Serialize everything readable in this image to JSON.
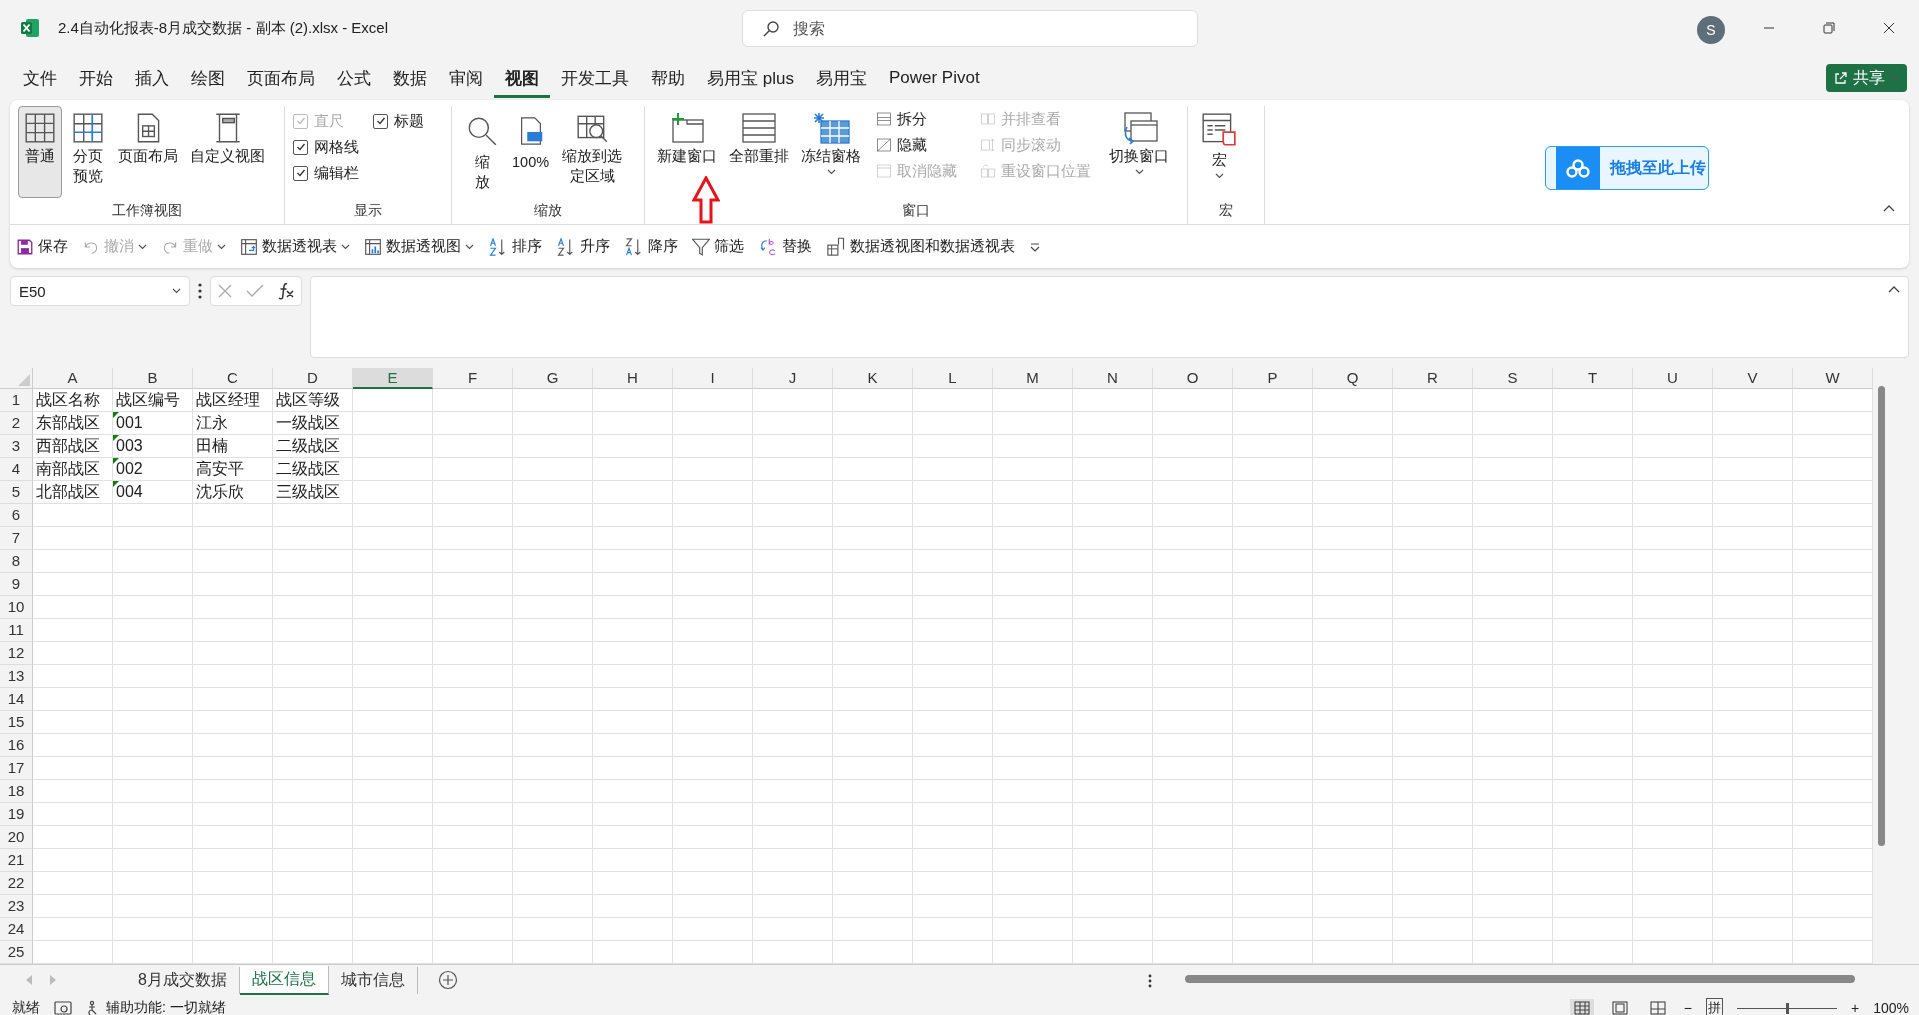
{
  "window": {
    "title": "2.4自动化报表-8月成交数据 - 副本 (2).xlsx  -  Excel",
    "search": {
      "placeholder": "搜索"
    },
    "avatar": "S"
  },
  "menu_tabs": [
    {
      "label": "文件",
      "selected": false
    },
    {
      "label": "开始",
      "selected": false
    },
    {
      "label": "插入",
      "selected": false
    },
    {
      "label": "绘图",
      "selected": false
    },
    {
      "label": "页面布局",
      "selected": false
    },
    {
      "label": "公式",
      "selected": false
    },
    {
      "label": "数据",
      "selected": false
    },
    {
      "label": "审阅",
      "selected": false
    },
    {
      "label": "视图",
      "selected": true
    },
    {
      "label": "开发工具",
      "selected": false
    },
    {
      "label": "帮助",
      "selected": false
    },
    {
      "label": "易用宝 plus",
      "selected": false
    },
    {
      "label": "易用宝",
      "selected": false
    },
    {
      "label": "Power Pivot",
      "selected": false
    }
  ],
  "share_button": "共享",
  "ribbon": {
    "workbook_views": {
      "label": "工作簿视图",
      "buttons": [
        {
          "label": "普通",
          "selected": true
        },
        {
          "label": "分页预览",
          "selected": false
        },
        {
          "label": "页面布局",
          "selected": false
        },
        {
          "label": "自定义视图",
          "selected": false
        }
      ]
    },
    "show": {
      "label": "显示",
      "checkboxes": [
        {
          "label": "直尺",
          "checked": true,
          "disabled": true
        },
        {
          "label": "网格线",
          "checked": true,
          "disabled": false
        },
        {
          "label": "编辑栏",
          "checked": true,
          "disabled": false
        },
        {
          "label": "标题",
          "checked": true,
          "disabled": false
        }
      ]
    },
    "zoom": {
      "label": "缩放",
      "buttons": [
        {
          "label": "缩放"
        },
        {
          "label": "100%"
        },
        {
          "label": "缩放到选定区域"
        }
      ]
    },
    "window": {
      "label": "窗口",
      "big_buttons": [
        {
          "label": "新建窗口",
          "dropdown": false
        },
        {
          "label": "全部重排",
          "dropdown": false
        },
        {
          "label": "冻结窗格",
          "dropdown": true
        }
      ],
      "small_buttons": [
        {
          "label": "拆分",
          "disabled": false
        },
        {
          "label": "隐藏",
          "disabled": false
        },
        {
          "label": "取消隐藏",
          "disabled": true
        },
        {
          "label": "并排查看",
          "disabled": true
        },
        {
          "label": "同步滚动",
          "disabled": true
        },
        {
          "label": "重设窗口位置",
          "disabled": true
        }
      ],
      "switch_button": {
        "label": "切换窗口",
        "dropdown": true
      }
    },
    "macros": {
      "label": "宏",
      "button": {
        "label": "宏",
        "dropdown": true
      }
    },
    "upload_button": "拖拽至此上传"
  },
  "quick_access": [
    {
      "label": "保存",
      "disabled": false,
      "dropdown": false
    },
    {
      "label": "撤消",
      "disabled": true,
      "dropdown": true
    },
    {
      "label": "重做",
      "disabled": true,
      "dropdown": true
    },
    {
      "label": "数据透视表",
      "disabled": false,
      "dropdown": true
    },
    {
      "label": "数据透视图",
      "disabled": false,
      "dropdown": true
    },
    {
      "label": "排序",
      "disabled": false,
      "dropdown": false
    },
    {
      "label": "升序",
      "disabled": false,
      "dropdown": false
    },
    {
      "label": "降序",
      "disabled": false,
      "dropdown": false
    },
    {
      "label": "筛选",
      "disabled": false,
      "dropdown": false
    },
    {
      "label": "替换",
      "disabled": false,
      "dropdown": false
    },
    {
      "label": "数据透视图和数据透视表",
      "disabled": false,
      "dropdown": false
    }
  ],
  "formula_bar": {
    "name_box": "E50"
  },
  "grid": {
    "columns": [
      {
        "label": "A",
        "selected": false
      },
      {
        "label": "B",
        "selected": false
      },
      {
        "label": "C",
        "selected": false
      },
      {
        "label": "D",
        "selected": false
      },
      {
        "label": "E",
        "selected": true
      },
      {
        "label": "F",
        "selected": false
      },
      {
        "label": "G",
        "selected": false
      },
      {
        "label": "H",
        "selected": false
      },
      {
        "label": "I",
        "selected": false
      },
      {
        "label": "J",
        "selected": false
      },
      {
        "label": "K",
        "selected": false
      },
      {
        "label": "L",
        "selected": false
      },
      {
        "label": "M",
        "selected": false
      },
      {
        "label": "N",
        "selected": false
      },
      {
        "label": "O",
        "selected": false
      },
      {
        "label": "P",
        "selected": false
      },
      {
        "label": "Q",
        "selected": false
      },
      {
        "label": "R",
        "selected": false
      },
      {
        "label": "S",
        "selected": false
      },
      {
        "label": "T",
        "selected": false
      },
      {
        "label": "U",
        "selected": false
      },
      {
        "label": "V",
        "selected": false
      },
      {
        "label": "W",
        "selected": false
      }
    ],
    "rows": [
      {
        "label": "1",
        "cells": [
          {
            "text": "战区名称",
            "error_mark": false
          },
          {
            "text": "战区编号",
            "error_mark": false
          },
          {
            "text": "战区经理",
            "error_mark": false
          },
          {
            "text": "战区等级",
            "error_mark": false
          }
        ]
      },
      {
        "label": "2",
        "cells": [
          {
            "text": "东部战区",
            "error_mark": false
          },
          {
            "text": "001",
            "error_mark": true
          },
          {
            "text": "江永",
            "error_mark": false
          },
          {
            "text": "一级战区",
            "error_mark": false
          }
        ]
      },
      {
        "label": "3",
        "cells": [
          {
            "text": "西部战区",
            "error_mark": false
          },
          {
            "text": "003",
            "error_mark": true
          },
          {
            "text": "田楠",
            "error_mark": false
          },
          {
            "text": "二级战区",
            "error_mark": false
          }
        ]
      },
      {
        "label": "4",
        "cells": [
          {
            "text": "南部战区",
            "error_mark": false
          },
          {
            "text": "002",
            "error_mark": true
          },
          {
            "text": "高安平",
            "error_mark": false
          },
          {
            "text": "二级战区",
            "error_mark": false
          }
        ]
      },
      {
        "label": "5",
        "cells": [
          {
            "text": "北部战区",
            "error_mark": false
          },
          {
            "text": "004",
            "error_mark": true
          },
          {
            "text": "沈乐欣",
            "error_mark": false
          },
          {
            "text": "三级战区",
            "error_mark": false
          }
        ]
      },
      {
        "label": "6"
      },
      {
        "label": "7"
      },
      {
        "label": "8"
      },
      {
        "label": "9"
      },
      {
        "label": "10"
      },
      {
        "label": "11"
      },
      {
        "label": "12"
      },
      {
        "label": "13"
      },
      {
        "label": "14"
      },
      {
        "label": "15"
      },
      {
        "label": "16"
      },
      {
        "label": "17"
      },
      {
        "label": "18"
      },
      {
        "label": "19"
      },
      {
        "label": "20"
      },
      {
        "label": "21"
      },
      {
        "label": "22"
      },
      {
        "label": "23"
      },
      {
        "label": "24"
      },
      {
        "label": "25"
      }
    ]
  },
  "sheet_tabs": [
    {
      "label": "8月成交数据",
      "selected": false
    },
    {
      "label": "战区信息",
      "selected": true
    },
    {
      "label": "城市信息",
      "selected": false
    }
  ],
  "status_bar": {
    "status": "就绪",
    "accessibility": "辅助功能: 一切就绪",
    "views": [
      {
        "selected": true
      },
      {
        "selected": false
      },
      {
        "selected": false
      }
    ],
    "minus": "−",
    "ime": "拼",
    "plus": "+",
    "zoom": {
      "level": 0.5,
      "reading": "100%"
    }
  }
}
